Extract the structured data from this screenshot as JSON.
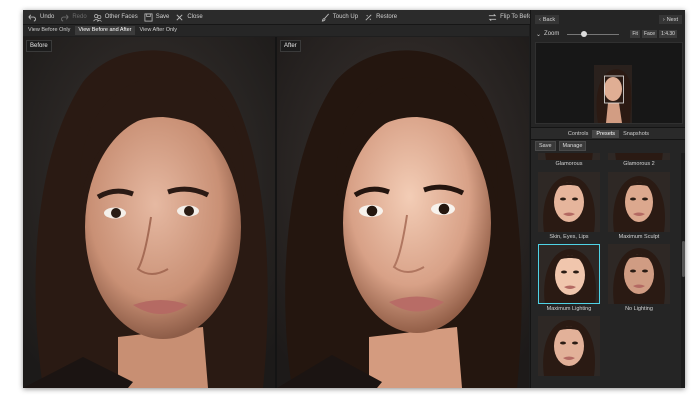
{
  "toolbar": {
    "undo": "Undo",
    "redo": "Redo",
    "other_faces": "Other Faces",
    "save": "Save",
    "close": "Close",
    "touch_up": "Touch Up",
    "restore": "Restore",
    "flip": "Flip To Before"
  },
  "view_tabs": [
    "View Before Only",
    "View Before and After",
    "View After Only"
  ],
  "before_label": "Before",
  "after_label": "After",
  "panel": {
    "back": "Back",
    "next": "Next",
    "zoom_label": "Zoom",
    "fit": "Fit",
    "face": "Face",
    "ratio": "1:4.30",
    "tabs": [
      "Controls",
      "Presets",
      "Snapshots"
    ],
    "save": "Save",
    "manage": "Manage",
    "presets": [
      "Glamorous",
      "Glamorous 2",
      "Skin, Eyes, Lips",
      "Maximum Sculpt",
      "Maximum Lighting",
      "No Lighting"
    ],
    "selected_preset": "Maximum Lighting"
  },
  "colors": {
    "accent": "#4fd3e6",
    "background": "#1e1e1e"
  }
}
